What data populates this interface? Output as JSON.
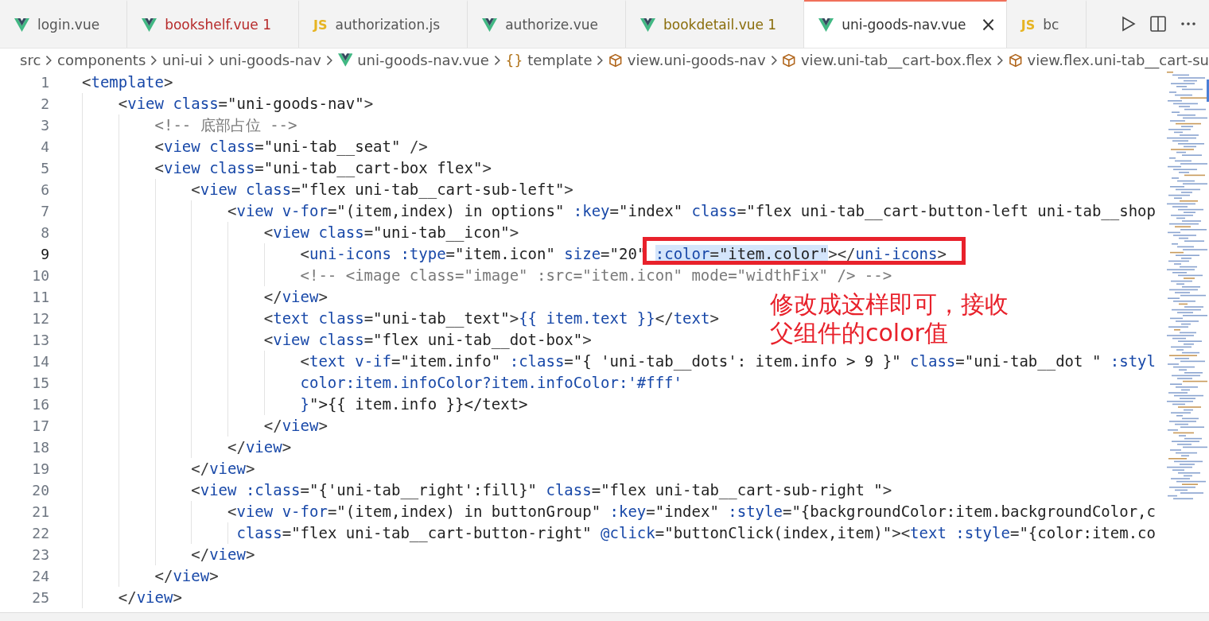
{
  "tabs": [
    {
      "label": "login.vue",
      "kind": "vue",
      "error": false,
      "warning": false,
      "selected": false
    },
    {
      "label": "bookshelf.vue",
      "kind": "vue",
      "error": true,
      "warning": false,
      "problems": "1",
      "selected": false
    },
    {
      "label": "authorization.js",
      "kind": "js",
      "badge": "JS",
      "error": false,
      "warning": false,
      "selected": false
    },
    {
      "label": "authorize.vue",
      "kind": "vue",
      "error": false,
      "warning": false,
      "selected": false
    },
    {
      "label": "bookdetail.vue",
      "kind": "vue",
      "error": false,
      "warning": true,
      "problems": "1",
      "selected": false
    },
    {
      "label": "uni-goods-nav.vue",
      "kind": "vue",
      "error": false,
      "warning": false,
      "selected": true,
      "close": "×"
    },
    {
      "label": "bc",
      "kind": "js",
      "badge": "JS",
      "error": false,
      "warning": false,
      "selected": false
    }
  ],
  "breadcrumb": [
    {
      "label": "src",
      "kind": "plain"
    },
    {
      "label": "components",
      "kind": "plain"
    },
    {
      "label": "uni-ui",
      "kind": "plain"
    },
    {
      "label": "uni-goods-nav",
      "kind": "plain"
    },
    {
      "label": "uni-goods-nav.vue",
      "kind": "vue"
    },
    {
      "label": "template",
      "kind": "braces",
      "glyph": "{}"
    },
    {
      "label": "view.uni-goods-nav",
      "kind": "element"
    },
    {
      "label": "view.uni-tab__cart-box.flex",
      "kind": "element"
    },
    {
      "label": "view.flex.uni-tab__cart-su",
      "kind": "element"
    }
  ],
  "lines": [
    {
      "number": "1",
      "code": "<template>",
      "kind": "code",
      "current": false
    },
    {
      "number": "2",
      "code": "    <view class=\"uni-goods-nav\">",
      "kind": "code",
      "current": false
    },
    {
      "number": "3",
      "code": "        <!-- 底部占位 -->",
      "kind": "comment",
      "current": false
    },
    {
      "number": "4",
      "code": "        <view class=\"uni-tab__seat\" />",
      "kind": "code",
      "current": false
    },
    {
      "number": "5",
      "code": "        <view class=\"uni-tab__cart-box flex\">",
      "kind": "code",
      "current": false
    },
    {
      "number": "6",
      "code": "            <view class=\"flex uni-tab__cart-sub-left\">",
      "kind": "code",
      "current": false
    },
    {
      "number": "7",
      "code": "                <view v-for=\"(item,index) in options\" :key=\"index\" class=\"flex uni-tab__cart-button-left uni-tab__shop",
      "kind": "code",
      "current": false
    },
    {
      "number": "8",
      "code": "                    <view class=\"uni-tab__icon\">",
      "kind": "code",
      "current": false
    },
    {
      "number": "9",
      "code": "                        <uni-icons :type=\"item.icon\" size=\"20\" ",
      "highlight": ":color=\"item.color\"",
      "code_after": "></uni-icons>",
      "kind": "code",
      "current": true
    },
    {
      "number": "10",
      "code": "                        <!-- <image class=\"image\" :src=\"item.icon\" mode=\"widthFix\" /> -->",
      "kind": "comment",
      "current": false
    },
    {
      "number": "11",
      "code": "                    </view>",
      "kind": "code",
      "current": false
    },
    {
      "number": "12",
      "code": "                    <text class=\"uni-tab__text\">{{ item.text }}</text>",
      "kind": "code",
      "current": false
    },
    {
      "number": "13",
      "code": "                    <view class=\"flex uni-tab__dot-box\">",
      "kind": "code",
      "current": false
    },
    {
      "number": "14",
      "code": "                        <text v-if=\"item.info\" :class=\"{ 'uni-tab__dots': item.info > 9 }\" class=\"uni-tab__dot \" :styl",
      "kind": "code",
      "current": false
    },
    {
      "number": "15",
      "code": "                        color:item.infoColor?item.infoColor:'#fff'",
      "kind": "code",
      "current": false
    },
    {
      "number": "16",
      "code": "                        }\">{{ item.info }}</text>",
      "kind": "code",
      "current": false
    },
    {
      "number": "17",
      "code": "                    </view>",
      "kind": "code",
      "current": false
    },
    {
      "number": "18",
      "code": "                </view>",
      "kind": "code",
      "current": false
    },
    {
      "number": "19",
      "code": "            </view>",
      "kind": "code",
      "current": false
    },
    {
      "number": "20",
      "code": "            <view :class=\"{'uni-tab__right':fill}\" class=\"flex uni-tab__cart-sub-right \">",
      "kind": "code",
      "current": false
    },
    {
      "number": "21",
      "code": "                <view v-for=\"(item,index) in buttonGroup\" :key=\"index\" :style=\"{backgroundColor:item.backgroundColor,c",
      "kind": "code",
      "current": false
    },
    {
      "number": "22",
      "code": "                 class=\"flex uni-tab__cart-button-right\" @click=\"buttonClick(index,item)\"><text :style=\"{color:item.co",
      "kind": "code",
      "current": false
    },
    {
      "number": "23",
      "code": "            </view>",
      "kind": "code",
      "current": false
    },
    {
      "number": "24",
      "code": "        </view>",
      "kind": "code",
      "current": false
    },
    {
      "number": "25",
      "code": "    </view>",
      "kind": "code",
      "current": false
    }
  ],
  "annotation": [
    "修改成这样即可，接收",
    "父组件的color值"
  ]
}
